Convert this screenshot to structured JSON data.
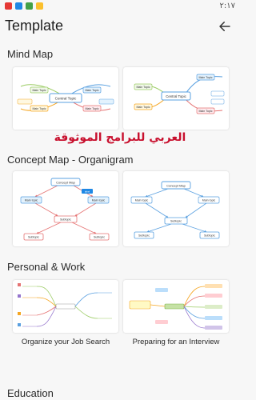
{
  "status_bar": {
    "time": "٢:١٧"
  },
  "header": {
    "title": "Template",
    "back_icon": "arrow-left-icon"
  },
  "watermark": "العربي للبرامج الموثوقة",
  "sections": [
    {
      "title": "Mind Map",
      "cards": [
        {
          "center": "Central Topic",
          "nodes": [
            "Main Topic",
            "Main Topic",
            "Main Topic",
            "Main Topic"
          ],
          "subs": [
            "Subtopic",
            "Subtopic",
            "Subtopic",
            "Subtopic"
          ]
        },
        {
          "center": "Central Topic",
          "nodes": [
            "Main Topic",
            "Main Topic",
            "Main Topic",
            "Main Topic"
          ],
          "subs": [
            "Subtopic",
            "Subtopic",
            "Subtopic",
            "Subtopic"
          ]
        }
      ]
    },
    {
      "title": "Concept Map - Organigram",
      "cards": [
        {
          "top": "Concept Map",
          "left": "Main topic",
          "right": "Main topic",
          "mid": "Subtopic",
          "bl": "Subtopic",
          "br": "Subtopic",
          "tag": "label"
        },
        {
          "top": "Concept Map",
          "left": "Main topic",
          "right": "Main topic",
          "mid": "Subtopic",
          "bl": "Subtopic",
          "br": "Subtopic"
        }
      ]
    },
    {
      "title": "Personal & Work",
      "cards": [
        {
          "caption": "Organize your Job Search"
        },
        {
          "caption": "Preparing for an Interview"
        }
      ]
    },
    {
      "title": "Education"
    }
  ],
  "colors": {
    "accent_green": "#9ccc65",
    "accent_blue": "#5aa0e0",
    "accent_orange": "#f5a623",
    "accent_red": "#e57373",
    "accent_purple": "#9575cd"
  }
}
